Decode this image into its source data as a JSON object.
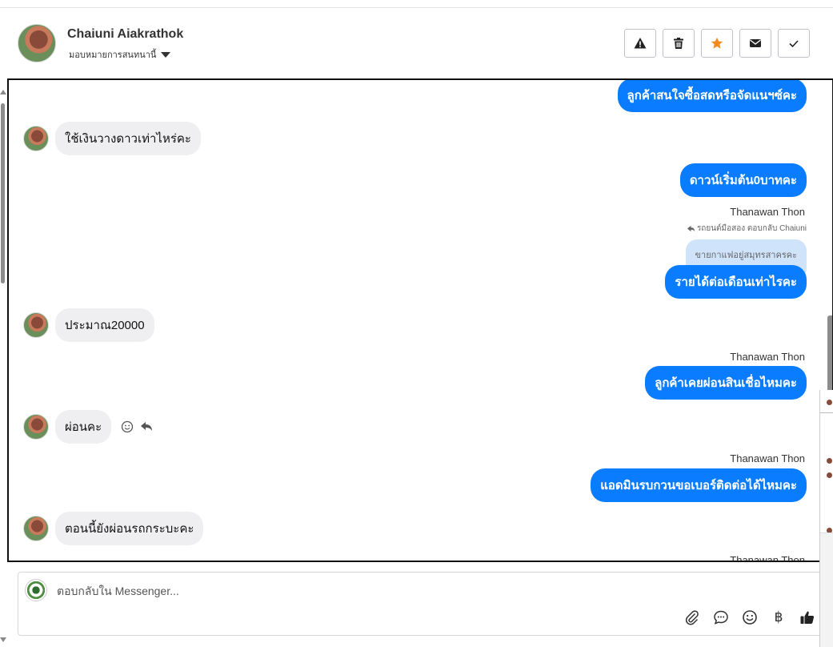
{
  "header": {
    "contact_name": "Chaiuni Aiakrathok",
    "assign_label": "มอบหมายการสนทนานี้",
    "actions": [
      "warning-icon",
      "trash-icon",
      "star-icon",
      "envelope-icon",
      "check-icon"
    ],
    "star_color": "#f28b1e"
  },
  "messages": {
    "m1": "ลูกค้าสนใจซื้อสดหรือจัดแนฯซ์คะ",
    "m2": "ใช้เงินวางดาวเท่าไหร่คะ",
    "m3": "ดาวน์เริ่มต้น0บาทคะ",
    "m4_sender": "Thanawan Thon",
    "m4_reply_note": "รถยนต์มือสอง ตอบกลับ Chaiuni",
    "m4_quoted": "ขายกาแฟอยู่สมุทรสาครคะ",
    "m4": "รายได้ต่อเดือนเท่าไรคะ",
    "m5": "ประมาณ20000",
    "m6_sender": "Thanawan Thon",
    "m6": "ลูกค้าเคยผ่อนสินเชื่อไหมคะ",
    "m7": "ผ่อนคะ",
    "m8_sender": "Thanawan Thon",
    "m8": "แอดมินรบกวนขอเบอร์ติดต่อได้ไหมคะ",
    "m9": "ตอนนี้ยังผ่อนรถกระบะคะ",
    "m10_sender": "Thanawan Thon"
  },
  "composer": {
    "placeholder": "ตอบกลับใน Messenger...",
    "tools": [
      "paperclip-icon",
      "chat-icon",
      "emoji-icon",
      "baht-icon",
      "thumbs-up-icon"
    ],
    "baht_symbol": "฿"
  },
  "colors": {
    "outgoing_bubble": "#0a7cff",
    "incoming_bubble": "#efeff1",
    "quoted_bubble": "#cfe3fb"
  }
}
